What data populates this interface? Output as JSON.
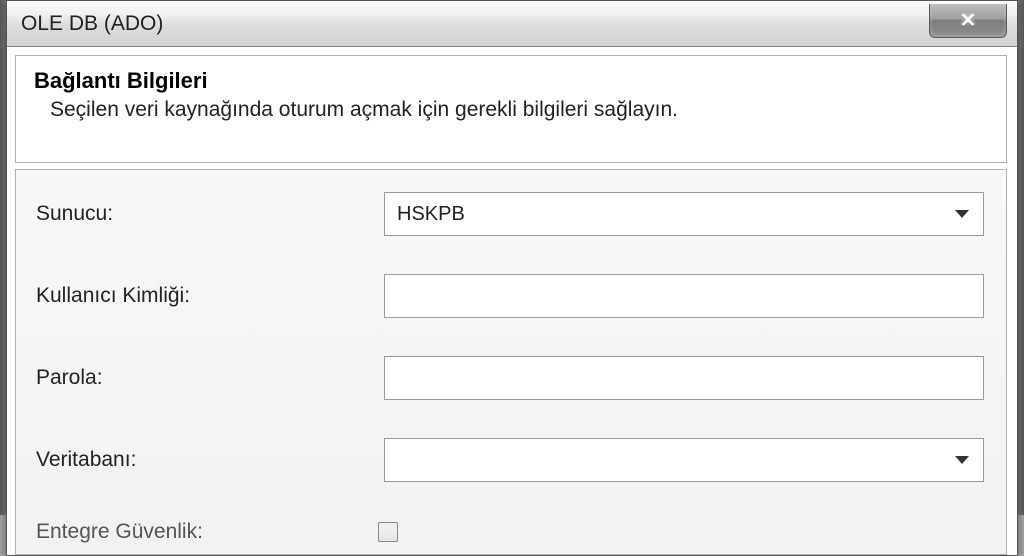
{
  "window": {
    "title": "OLE DB (ADO)"
  },
  "header": {
    "title": "Bağlantı Bilgileri",
    "subtitle": "Seçilen veri kaynağında oturum açmak için gerekli bilgileri sağlayın."
  },
  "form": {
    "server": {
      "label": "Sunucu:",
      "value": "HSKPB"
    },
    "user_id": {
      "label": "Kullanıcı Kimliği:",
      "value": ""
    },
    "password": {
      "label": "Parola:",
      "value": ""
    },
    "database": {
      "label": "Veritabanı:",
      "value": ""
    },
    "integrated_security": {
      "label": "Entegre Güvenlik:",
      "checked": false
    }
  }
}
